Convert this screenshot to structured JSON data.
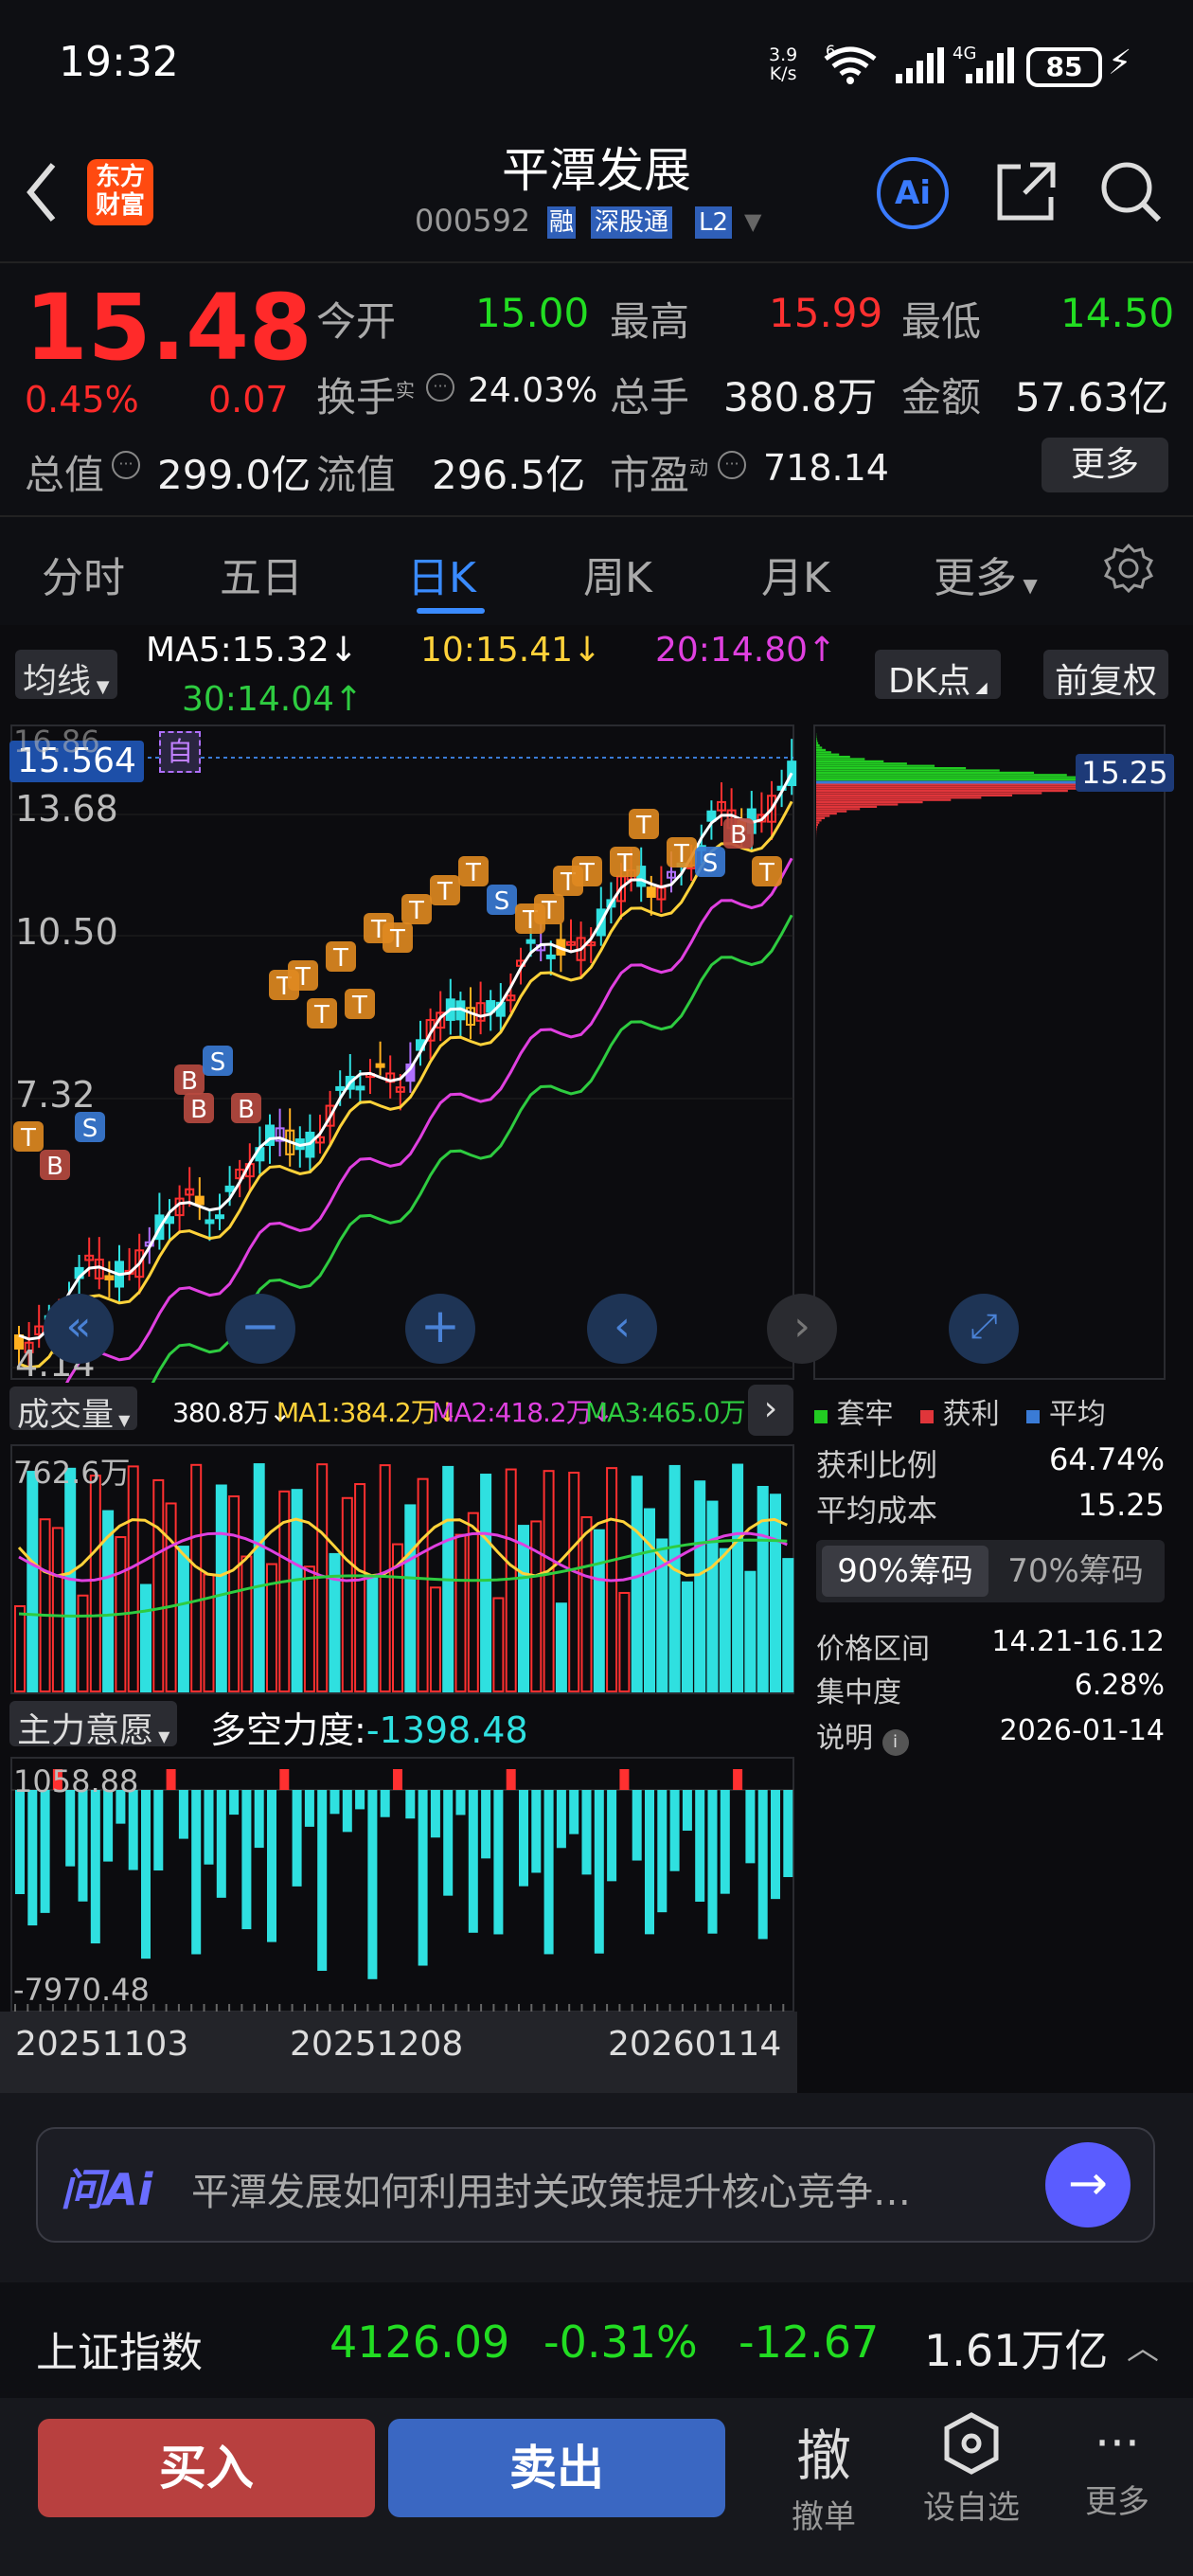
{
  "status_bar": {
    "time": "19:32",
    "net_speed_top": "3.9",
    "net_speed_bottom": "K/s",
    "wifi_tag": "6",
    "mobile_tag": "4G",
    "battery": "85"
  },
  "header": {
    "logo_line1": "东方",
    "logo_line2": "财富",
    "stock_name": "平潭发展",
    "stock_code": "000592",
    "tags": [
      "融",
      "深股通",
      "L2"
    ],
    "ai_label": "Ai"
  },
  "quote": {
    "price": "15.48",
    "change_pct": "0.45%",
    "change": "0.07",
    "fields": [
      {
        "label": "今开",
        "value": "15.00"
      },
      {
        "label": "最高",
        "value": "15.99"
      },
      {
        "label": "最低",
        "value": "14.50"
      },
      {
        "label": "换手",
        "sup": "实",
        "value": "24.03%"
      },
      {
        "label": "总手",
        "value": "380.8万"
      },
      {
        "label": "金额",
        "value": "57.63亿"
      },
      {
        "label": "总值",
        "value": "299.0亿"
      },
      {
        "label": "流值",
        "value": "296.5亿"
      },
      {
        "label": "市盈",
        "sup": "动",
        "value": "718.14"
      }
    ],
    "more_label": "更多"
  },
  "tabs": [
    "分时",
    "五日",
    "日K",
    "周K",
    "月K",
    "更多"
  ],
  "active_tab": "日K",
  "kline": {
    "ma_dropdown": "均线",
    "ma5": "MA5:15.32↓",
    "ma10": "10:15.41↓",
    "ma20": "20:14.80↑",
    "ma30": "30:14.04↑",
    "dk_button": "DK点",
    "adjust_button": "前复权",
    "crosshair_price": "15.564",
    "self_tag": "自",
    "y_labels": [
      "16.86",
      "13.68",
      "10.50",
      "7.32",
      "4.14"
    ],
    "chip_price": "15.25",
    "markers": [
      "S",
      "B",
      "T"
    ]
  },
  "volume": {
    "title": "成交量",
    "v": "380.8万↓",
    "ma1": "MA1:384.2万↓",
    "ma2": "MA2:418.2万↓",
    "ma3": "MA3:465.0万↓",
    "ytop": "762.6万"
  },
  "force": {
    "title": "主力意愿",
    "label": "多空力度:",
    "value": "-1398.48",
    "ytop": "1058.88",
    "ybottom": "-7970.48"
  },
  "dates": [
    "20251103",
    "20251208",
    "20260114"
  ],
  "chips": {
    "legend": [
      "套牢",
      "获利",
      "平均"
    ],
    "rows": [
      {
        "label": "获利比例",
        "value": "64.74%"
      },
      {
        "label": "平均成本",
        "value": "15.25"
      }
    ],
    "tab90": "90%筹码",
    "tab70": "70%筹码",
    "rows2": [
      {
        "label": "价格区间",
        "value": "14.21-16.12"
      },
      {
        "label": "集中度",
        "value": "6.28%"
      },
      {
        "label": "说明",
        "value": "2026-01-14"
      }
    ]
  },
  "ai_bar": {
    "brand": "问Ai",
    "prompt": "平潭发展如何利用封关政策提升核心竞争…"
  },
  "index_bar": {
    "name": "上证指数",
    "price": "4126.09",
    "pct": "-0.31%",
    "chg": "-12.67",
    "amount": "1.61万亿"
  },
  "bottom": {
    "buy": "买入",
    "sell": "卖出",
    "cancel_big": "撤",
    "cancel": "撤单",
    "watch": "设自选",
    "more": "更多"
  }
}
